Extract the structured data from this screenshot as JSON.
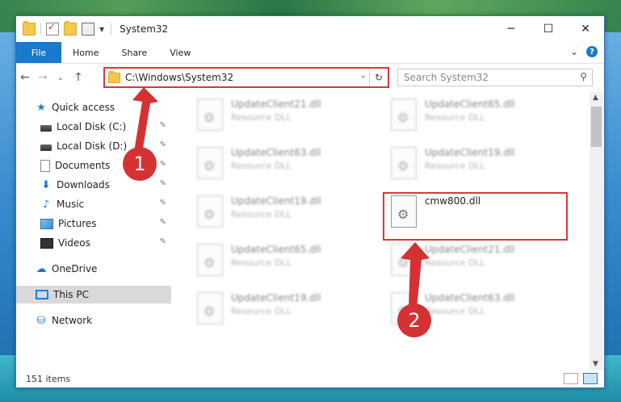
{
  "window": {
    "title": "System32",
    "controls": {
      "minimize": "─",
      "maximize": "☐",
      "close": "✕"
    }
  },
  "ribbon": {
    "tabs": [
      "File",
      "Home",
      "Share",
      "View"
    ],
    "collapse": "⌄",
    "help": "?"
  },
  "nav": {
    "back": "←",
    "forward": "→",
    "recent": "⌄",
    "up": "↑",
    "address": "C:\\Windows\\System32",
    "address_dropdown": "⌄",
    "refresh": "↻",
    "search_placeholder": "Search System32",
    "search_icon": "⚲"
  },
  "sidebar": {
    "items": [
      {
        "label": "Quick access",
        "icon": "star-icon",
        "pinned": false
      },
      {
        "label": "Local Disk (C:)",
        "icon": "disk-icon",
        "pinned": true
      },
      {
        "label": "Local Disk (D:)",
        "icon": "disk-icon",
        "pinned": true
      },
      {
        "label": "Documents",
        "icon": "document-icon",
        "pinned": true
      },
      {
        "label": "Downloads",
        "icon": "download-icon",
        "pinned": true
      },
      {
        "label": "Music",
        "icon": "music-icon",
        "pinned": true
      },
      {
        "label": "Pictures",
        "icon": "pictures-icon",
        "pinned": true
      },
      {
        "label": "Videos",
        "icon": "video-icon",
        "pinned": true
      },
      {
        "label": "OneDrive",
        "icon": "cloud-icon",
        "pinned": false
      },
      {
        "label": "This PC",
        "icon": "computer-icon",
        "pinned": false,
        "selected": true
      },
      {
        "label": "Network",
        "icon": "network-icon",
        "pinned": false
      }
    ],
    "pin_glyph": "📌"
  },
  "files": [
    {
      "name": "UpdateClient21.dll",
      "type": "Resource DLL"
    },
    {
      "name": "UpdateClient65.dll",
      "type": "Resource DLL"
    },
    {
      "name": "UpdateClient63.dll",
      "type": "Resource DLL"
    },
    {
      "name": "UpdateClient19.dll",
      "type": "Resource DLL"
    },
    {
      "name": "UpdateClient19.dll",
      "type": "Resource DLL"
    },
    {
      "name": "cmw800.dll",
      "type": "",
      "highlighted": true
    },
    {
      "name": "UpdateClient65.dll",
      "type": "Resource DLL"
    },
    {
      "name": "UpdateClient21.dll",
      "type": "Resource DLL"
    },
    {
      "name": "UpdateClient19.dll",
      "type": "Resource DLL"
    },
    {
      "name": "UpdateClient63.dll",
      "type": "Resource DLL"
    }
  ],
  "status": {
    "item_count": "151 items"
  },
  "annotations": {
    "step1": "1",
    "step2": "2",
    "color": "#d43232"
  }
}
